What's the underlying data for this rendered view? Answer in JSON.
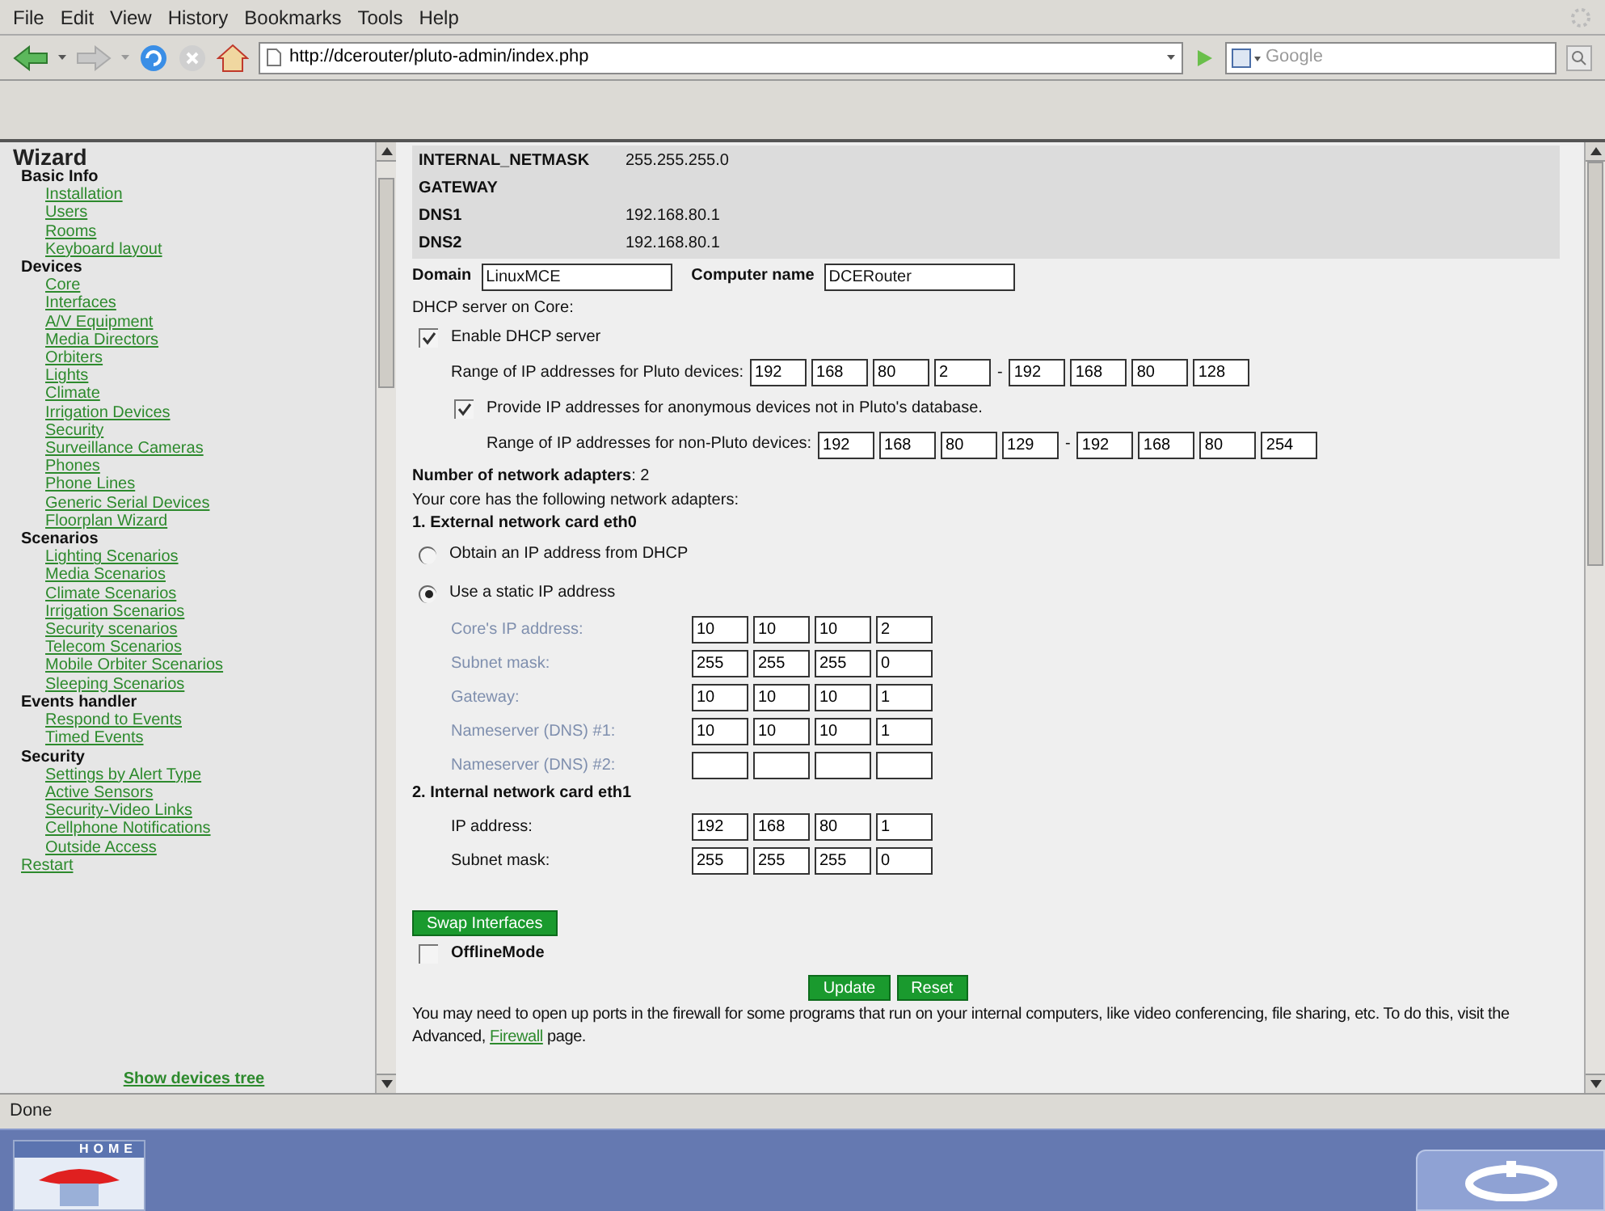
{
  "menu_bar": [
    "File",
    "Edit",
    "View",
    "History",
    "Bookmarks",
    "Tools",
    "Help"
  ],
  "address_bar": {
    "url": "http://dcerouter/pluto-admin/index.php"
  },
  "search_bar": {
    "placeholder": "Google"
  },
  "sidebar": {
    "title": "Wizard",
    "sections": [
      {
        "title": "Basic Info",
        "items": [
          "Installation",
          "Users",
          "Rooms",
          "Keyboard layout"
        ]
      },
      {
        "title": "Devices",
        "items": [
          "Core",
          "Interfaces",
          "A/V Equipment",
          "Media Directors",
          "Orbiters",
          "Lights",
          "Climate",
          "Irrigation Devices",
          "Security",
          "Surveillance Cameras",
          "Phones",
          "Phone Lines",
          "Generic Serial Devices",
          "Floorplan Wizard"
        ]
      },
      {
        "title": "Scenarios",
        "items": [
          "Lighting Scenarios",
          "Media Scenarios",
          "Climate Scenarios",
          "Irrigation Scenarios",
          "Security scenarios",
          "Telecom Scenarios",
          "Mobile Orbiter Scenarios",
          "Sleeping Scenarios"
        ]
      },
      {
        "title": "Events handler",
        "items": [
          "Respond to Events",
          "Timed Events"
        ]
      },
      {
        "title": "Security",
        "items": [
          "Settings by Alert Type",
          "Active Sensors",
          "Security-Video Links",
          "Cellphone Notifications",
          "Outside Access"
        ]
      }
    ],
    "restart_link": "Restart",
    "footer_link": "Show devices tree"
  },
  "info_table": [
    {
      "label": "INTERNAL_NETMASK",
      "value": "255.255.255.0"
    },
    {
      "label": "GATEWAY"
    },
    {
      "label": "DNS1",
      "value": "192.168.80.1"
    },
    {
      "label": "DNS2",
      "value": "192.168.80.1"
    }
  ],
  "domain": {
    "label": "Domain",
    "value": "LinuxMCE"
  },
  "computer_name": {
    "label": "Computer name",
    "value": "DCERouter"
  },
  "dhcp": {
    "heading": "DHCP server on Core:",
    "enable": {
      "label": "Enable DHCP server",
      "checked": true
    },
    "range": {
      "label": "Range of IP addresses for Pluto devices:",
      "separator": "-",
      "from": [
        "192",
        "168",
        "80",
        "2"
      ],
      "to": [
        "192",
        "168",
        "80",
        "128"
      ]
    },
    "anonymous": {
      "label": "Provide IP addresses for anonymous devices not in Pluto's database.",
      "checked": true
    },
    "range_non_pluto": {
      "label": "Range of IP addresses for non-Pluto devices:",
      "separator": "-",
      "from": [
        "192",
        "168",
        "80",
        "129"
      ],
      "to": [
        "192",
        "168",
        "80",
        "254"
      ]
    }
  },
  "adapter_count": "**Number of network adapters**: 2",
  "adapters_intro": "Your core has the following network adapters:",
  "adapters": [
    {
      "kind": "external",
      "title": "1. External network card eth0",
      "modes": [
        {
          "label": "Obtain an IP address from DHCP",
          "selected": false
        },
        {
          "label": "Use a static IP address",
          "selected": true
        }
      ],
      "fields": [
        {
          "label": "Core's IP address:",
          "octets": [
            "10",
            "10",
            "10",
            "2"
          ]
        },
        {
          "label": "Subnet mask:",
          "octets": [
            "255",
            "255",
            "255",
            "0"
          ]
        },
        {
          "label": "Gateway:",
          "octets": [
            "10",
            "10",
            "10",
            "1"
          ]
        },
        {
          "label": "Nameserver (DNS) #1:",
          "octets": [
            "10",
            "10",
            "10",
            "1"
          ]
        },
        {
          "label": "Nameserver (DNS) #2:"
        }
      ]
    },
    {
      "kind": "internal",
      "title": "2. Internal network card eth1",
      "fields": [
        {
          "label": "IP address:",
          "octets": [
            "192",
            "168",
            "80",
            "1"
          ]
        },
        {
          "label": "Subnet mask:",
          "octets": [
            "255",
            "255",
            "255",
            "0"
          ]
        }
      ]
    }
  ],
  "swap_button": "Swap Interfaces",
  "offline": {
    "label": "OfflineMode",
    "checked": false
  },
  "buttons": [
    "Update",
    "Reset"
  ],
  "note": {
    "text": "You may need to open up ports in the firewall for some programs that run on your internal computers, like video conferencing, file sharing, etc. To do this, visit the Advanced, ",
    "link": "Firewall",
    "after": " page."
  },
  "status_bar": "Done",
  "taskbar": {
    "home_label": "HOME"
  }
}
